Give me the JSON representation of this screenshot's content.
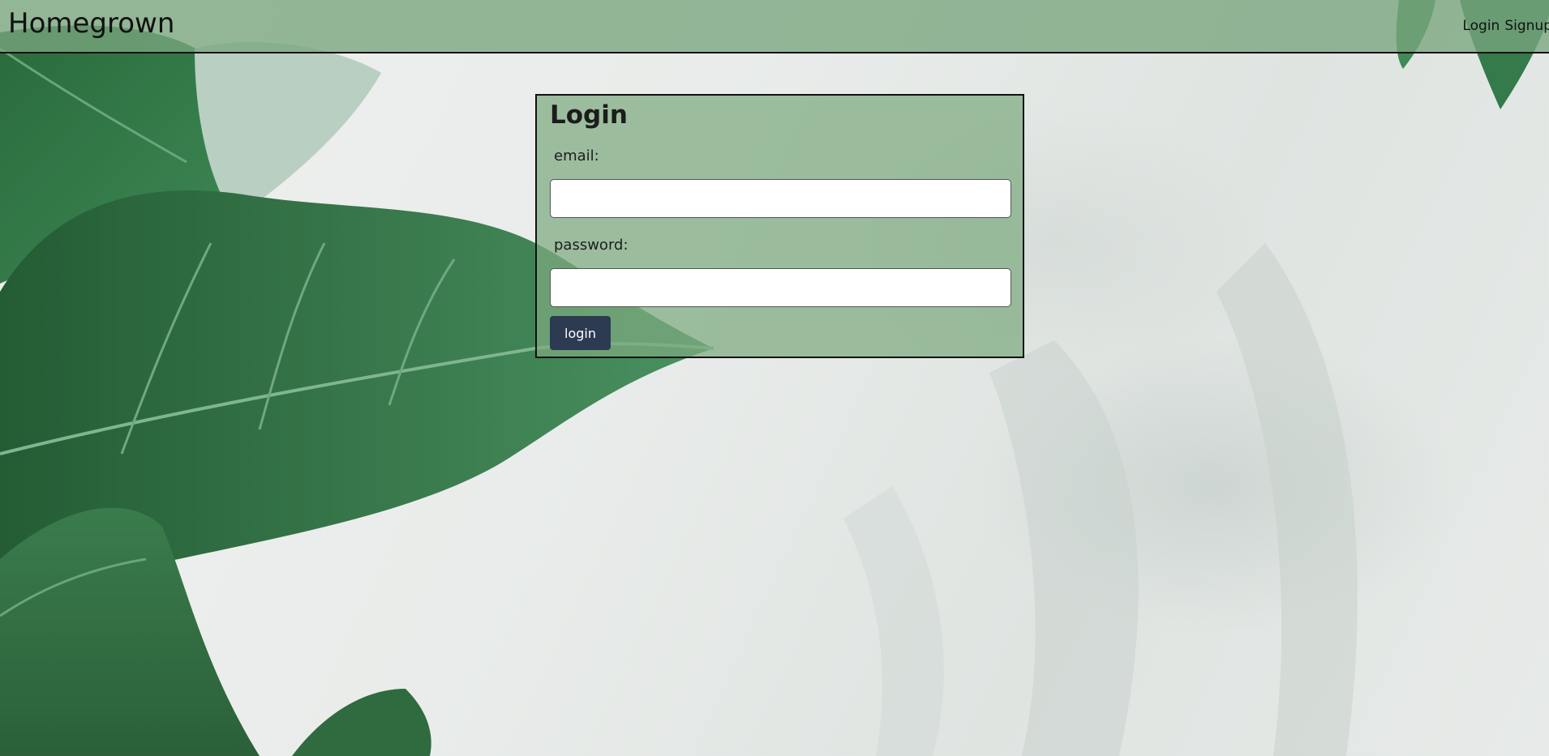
{
  "navbar": {
    "brand": "Homegrown",
    "links": [
      "Login",
      "Signup"
    ]
  },
  "login_form": {
    "title": "Login",
    "email_label": "email:",
    "email_value": "",
    "password_label": "password:",
    "password_value": "",
    "submit_label": "login"
  },
  "colors": {
    "navbar_bg": "#78a57d",
    "card_bg": "#7daa80",
    "button_bg": "#2c3a52",
    "leaf_green": "#2f6b3f"
  }
}
